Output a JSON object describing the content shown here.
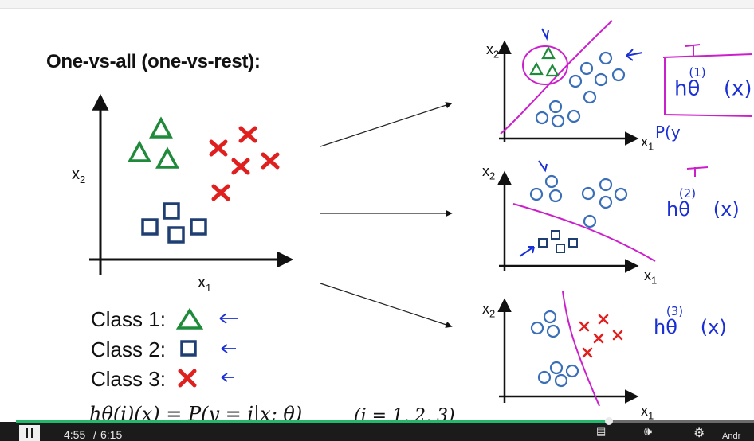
{
  "slide": {
    "title": "One-vs-all (one-vs-rest):",
    "legend": [
      {
        "label": "Class 1:",
        "symbol": "triangle"
      },
      {
        "label": "Class 2:",
        "symbol": "square"
      },
      {
        "label": "Class 3:",
        "symbol": "cross"
      }
    ],
    "formula": "h_θ^(i)(x) = P(y = i|x; θ)",
    "formula_main": "hθ(i)(x) = P(y = i|x; θ)",
    "formula_range": "(i = 1, 2, 3)",
    "axes": {
      "x_label": "x",
      "x_sub": "1",
      "y_label": "x",
      "y_sub": "2"
    },
    "annotations": {
      "h1": "hθ(1)(x)",
      "h1_sup": "(1)",
      "h2_sup": "(2)",
      "h3_sup": "(3)",
      "h_base": "hθ",
      "h_arg": "(x)",
      "p_note": "P(y"
    }
  },
  "colors": {
    "triangle": "#1f8a3a",
    "square": "#1f3f73",
    "cross": "#e01f1f",
    "circle": "#3a6fb8",
    "boundary": "#cc1fcc",
    "ink": "#1a2fd6",
    "progress": "#23b86b"
  },
  "player": {
    "current_time": "4:55",
    "separator": "/",
    "duration": "6:15",
    "progress": 0.803,
    "play_state": "pause-icon",
    "corner_text": "Andr"
  }
}
